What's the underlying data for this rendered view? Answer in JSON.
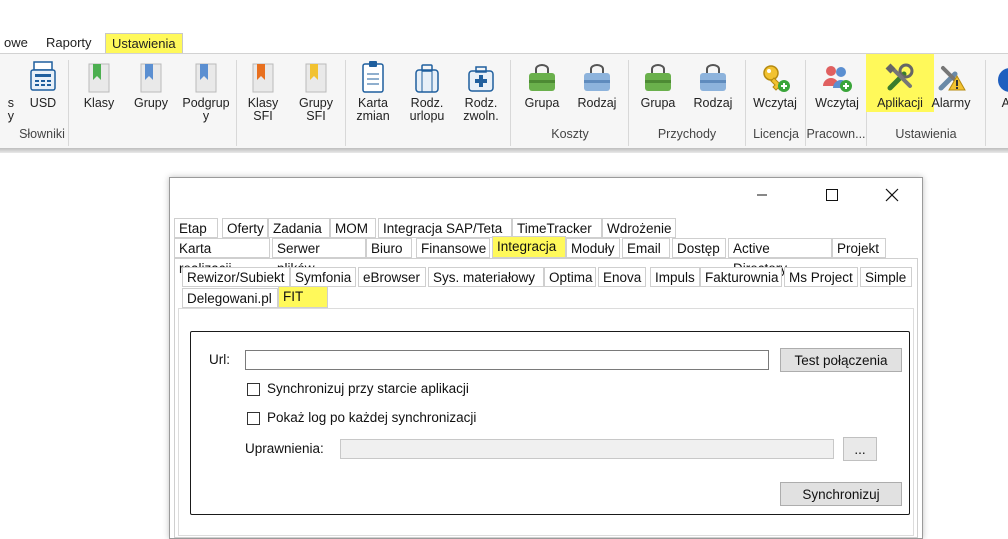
{
  "ribbon": {
    "tabs": [
      {
        "label": "owe"
      },
      {
        "label": "Raporty"
      },
      {
        "label": "Ustawienia",
        "active": true
      }
    ],
    "buttons": {
      "s_partial": "s\ny",
      "usd": "USD",
      "klasy": "Klasy",
      "grupy": "Grupy",
      "podgrupy": "Podgrup\ny",
      "klasy_sfi": "Klasy\nSFI",
      "grupy_sfi": "Grupy\nSFI",
      "karta_zmian": "Karta\nzmian",
      "rodz_urlopu": "Rodz.\nurlopu",
      "rodz_zwoln": "Rodz.\nzwoln.",
      "koszty_grupa": "Grupa",
      "koszty_rodzaj": "Rodzaj",
      "przychody_grupa": "Grupa",
      "przychody_rodzaj": "Rodzaj",
      "licencja_wczytaj": "Wczytaj",
      "pracown_wczytaj": "Wczytaj",
      "aplikacji": "Aplikacji",
      "alarmy": "Alarmy",
      "a_partial": "A"
    },
    "groups": {
      "slowniki": "Słowniki",
      "koszty": "Koszty",
      "przychody": "Przychody",
      "licencja": "Licencja",
      "pracown": "Pracown...",
      "ustawienia": "Ustawienia"
    }
  },
  "dialog": {
    "tabs_row1": [
      "Etap",
      "Oferty",
      "Zadania",
      "MOM",
      "Integracja SAP/Teta",
      "TimeTracker",
      "Wdrożenie"
    ],
    "tabs_row2": [
      "Karta realizacji",
      "Serwer plików",
      "Biuro",
      "Finansowe",
      "Integracja",
      "Moduły",
      "Email",
      "Dostęp",
      "Active Directory",
      "Projekt"
    ],
    "selected_tab": "Integracja",
    "subtabs_row1": [
      "Rewizor/Subiekt",
      "Symfonia",
      "eBrowser",
      "Sys. materiałowy",
      "Optima",
      "Enova",
      "Impuls",
      "Fakturownia",
      "Ms Project",
      "Simple"
    ],
    "subtabs_row2": [
      "Delegowani.pl",
      "FIT"
    ],
    "selected_subtab": "FIT",
    "fit": {
      "url_label": "Url:",
      "url_value": "",
      "test_button": "Test połączenia",
      "sync_on_start": "Synchronizuj przy starcie aplikacji",
      "show_log": "Pokaż log po każdej synchronizacji",
      "permissions_label": "Uprawnienia:",
      "permissions_value": "",
      "browse_button": "...",
      "sync_button": "Synchronizuj"
    }
  },
  "colors": {
    "highlight": "#fff95a",
    "ribbon_bg": "#f6f6f6",
    "button_bg": "#e1e1e1"
  }
}
